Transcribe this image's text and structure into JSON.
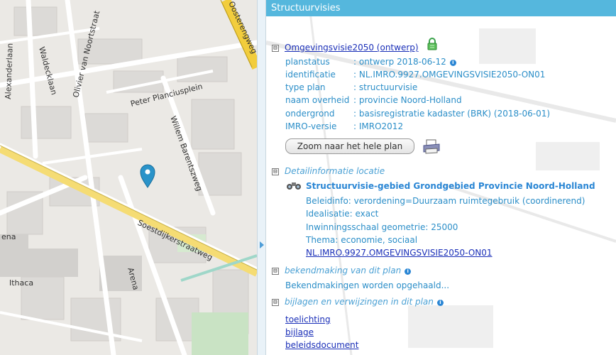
{
  "map": {
    "streets": [
      "Oosterengweg",
      "Alexanderlaan",
      "Waldecklaan",
      "Olivier van Noortstraat",
      "Peter Planciusplein",
      "Willem Barentszweg",
      "Soestdijkerstraatweg",
      "Arena",
      "Ithaca",
      "ena"
    ],
    "marker": "location-pin-icon"
  },
  "panel": {
    "title": "Structuurvisies",
    "plan": {
      "toggle": "⊟",
      "name": "Omgevingsvisie2050 (ontwerp)",
      "lock_icon": "lock-icon",
      "fields": [
        {
          "label": "planstatus",
          "value": ": ontwerp 2018-06-12",
          "info": true
        },
        {
          "label": "identificatie",
          "value": ": NL.IMRO.9927.OMGEVINGSVISIE2050-ON01",
          "info": false
        },
        {
          "label": "type plan",
          "value": ": structuurvisie",
          "info": false
        },
        {
          "label": "naam overheid",
          "value": ": provincie Noord-Holland",
          "info": false
        },
        {
          "label": "ondergrond",
          "value": ": basisregistratie kadaster (BRK) (2018-06-01)",
          "info": false
        },
        {
          "label": "IMRO-versie",
          "value": ": IMRO2012",
          "info": false
        }
      ],
      "zoom_button": "Zoom naar het hele plan",
      "print_icon": "printer-icon"
    },
    "detail": {
      "toggle": "⊟",
      "heading": "Detailinformatie locatie",
      "binoculars_icon": "binoculars-icon",
      "title": "Structuurvisie-gebied Grondgebied Provincie Noord-Holland",
      "lines": [
        "Beleidinfo: verordening=Duurzaam ruimtegebruik (coordinerend)",
        "Idealisatie: exact",
        "Inwinningsschaal geometrie: 25000",
        "Thema: economie, sociaal"
      ],
      "link": "NL.IMRO.9927.OMGEVINGSVISIE2050-ON01"
    },
    "bekendmaking": {
      "toggle": "⊟",
      "heading": "bekendmaking van dit plan",
      "status": "Bekendmakingen worden opgehaald..."
    },
    "bijlagen": {
      "toggle": "⊟",
      "heading": "bijlagen en verwijzingen in dit plan",
      "links": [
        "toelichting",
        "bijlage",
        "beleidsdocument"
      ]
    }
  },
  "colors": {
    "titlebar": "#55b7dd",
    "link": "#1a2fb8",
    "text": "#2b8ec8"
  }
}
